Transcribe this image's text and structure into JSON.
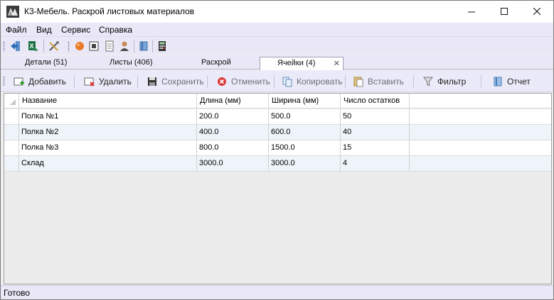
{
  "window": {
    "title": "К3-Мебель. Раскрой листовых материалов"
  },
  "menu": [
    {
      "label": "Файл"
    },
    {
      "label": "Вид"
    },
    {
      "label": "Сервис"
    },
    {
      "label": "Справка"
    }
  ],
  "toolbar_icons": [
    "back-arrow-icon",
    "excel-icon",
    "tools-icon",
    "ball-icon",
    "frame-icon",
    "page-icon",
    "user-icon",
    "book-icon",
    "calculator-icon"
  ],
  "tabs": [
    {
      "label": "Детали (51)",
      "active": false
    },
    {
      "label": "Листы (406)",
      "active": false
    },
    {
      "label": "Раскрой",
      "active": false
    },
    {
      "label": "Ячейки (4)",
      "active": true
    }
  ],
  "actions": [
    {
      "label": "Добавить",
      "icon": "add-icon",
      "enabled": true
    },
    {
      "label": "Удалить",
      "icon": "delete-icon",
      "enabled": true
    },
    {
      "label": "Сохранить",
      "icon": "save-icon",
      "enabled": false
    },
    {
      "label": "Отменить",
      "icon": "cancel-icon",
      "enabled": false
    },
    {
      "label": "Копировать",
      "icon": "copy-icon",
      "enabled": false
    },
    {
      "label": "Вставить",
      "icon": "paste-icon",
      "enabled": false
    },
    {
      "label": "Фильтр",
      "icon": "filter-icon",
      "enabled": true
    },
    {
      "label": "Отчет",
      "icon": "report-icon",
      "enabled": true
    }
  ],
  "table": {
    "columns": [
      "Название",
      "Длина (мм)",
      "Ширина (мм)",
      "Число остатков"
    ],
    "rows": [
      [
        "Полка №1",
        "200.0",
        "500.0",
        "50"
      ],
      [
        "Полка №2",
        "400.0",
        "600.0",
        "40"
      ],
      [
        "Полка №3",
        "800.0",
        "1500.0",
        "15"
      ],
      [
        "Склад",
        "3000.0",
        "3000.0",
        "4"
      ]
    ]
  },
  "status": {
    "text": "Готово"
  },
  "colors": {
    "chrome": "#eae8f7",
    "row_alt": "#eef4fa"
  }
}
